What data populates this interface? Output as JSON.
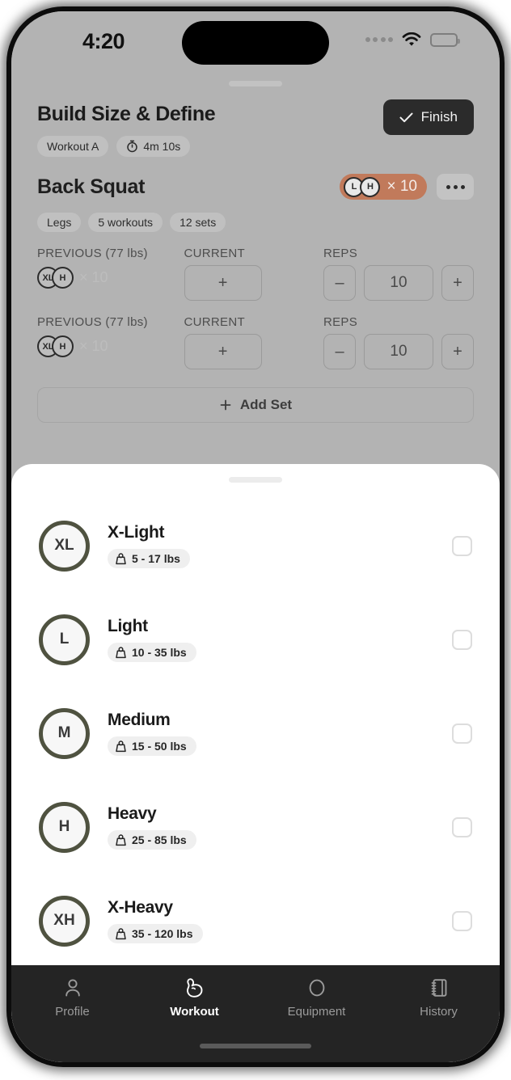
{
  "status_bar": {
    "time": "4:20",
    "signal_icon": "signal-dots-icon",
    "wifi_icon": "wifi-icon",
    "battery_icon": "battery-full-icon"
  },
  "header": {
    "title": "Build Size & Define",
    "chips": [
      {
        "label": "Workout A",
        "icon": null
      },
      {
        "label": "4m 10s",
        "icon": "stopwatch-icon"
      }
    ],
    "finish_button": {
      "label": "Finish",
      "icon": "check-icon"
    }
  },
  "exercise": {
    "name": "Back Squat",
    "intensity_badge": {
      "circles": [
        "L",
        "H"
      ],
      "count": "× 10"
    },
    "more_button_icon": "ellipsis-icon",
    "tags": [
      "Legs",
      "5 workouts",
      "12 sets"
    ],
    "column_labels": {
      "previous": "PREVIOUS (77 lbs)",
      "current": "CURRENT",
      "reps": "REPS"
    },
    "sets": [
      {
        "previous": {
          "circles": [
            "XL",
            "H"
          ],
          "count": "× 10"
        },
        "current": "+",
        "reps": {
          "minus": "–",
          "value": "10",
          "plus": "+"
        }
      },
      {
        "previous": {
          "circles": [
            "XL",
            "H"
          ],
          "count": "× 10"
        },
        "current": "+",
        "reps": {
          "minus": "–",
          "value": "10",
          "plus": "+"
        }
      }
    ],
    "add_set_button": {
      "label": "Add Set",
      "icon": "plus-icon"
    }
  },
  "sheet": {
    "handle_icon": "drag-handle-icon",
    "weight_options": [
      {
        "abbr": "XL",
        "name": "X-Light",
        "range": "5 - 17 lbs",
        "icon": "weight-icon",
        "checked": false
      },
      {
        "abbr": "L",
        "name": "Light",
        "range": "10 - 35 lbs",
        "icon": "weight-icon",
        "checked": false
      },
      {
        "abbr": "M",
        "name": "Medium",
        "range": "15 - 50 lbs",
        "icon": "weight-icon",
        "checked": false
      },
      {
        "abbr": "H",
        "name": "Heavy",
        "range": "25 - 85 lbs",
        "icon": "weight-icon",
        "checked": false
      },
      {
        "abbr": "XH",
        "name": "X-Heavy",
        "range": "35 - 120 lbs",
        "icon": "weight-icon",
        "checked": false
      }
    ]
  },
  "bottom_nav": {
    "items": [
      {
        "label": "Profile",
        "icon": "person-icon",
        "active": false
      },
      {
        "label": "Workout",
        "icon": "bicep-icon",
        "active": true
      },
      {
        "label": "Equipment",
        "icon": "ring-icon",
        "active": false
      },
      {
        "label": "History",
        "icon": "notebook-icon",
        "active": false
      }
    ]
  },
  "colors": {
    "accent_terracotta": "#c17a5b",
    "ring_olive": "#4f5240",
    "nav_dark": "#242424",
    "dim_background": "#b3b3b3"
  }
}
